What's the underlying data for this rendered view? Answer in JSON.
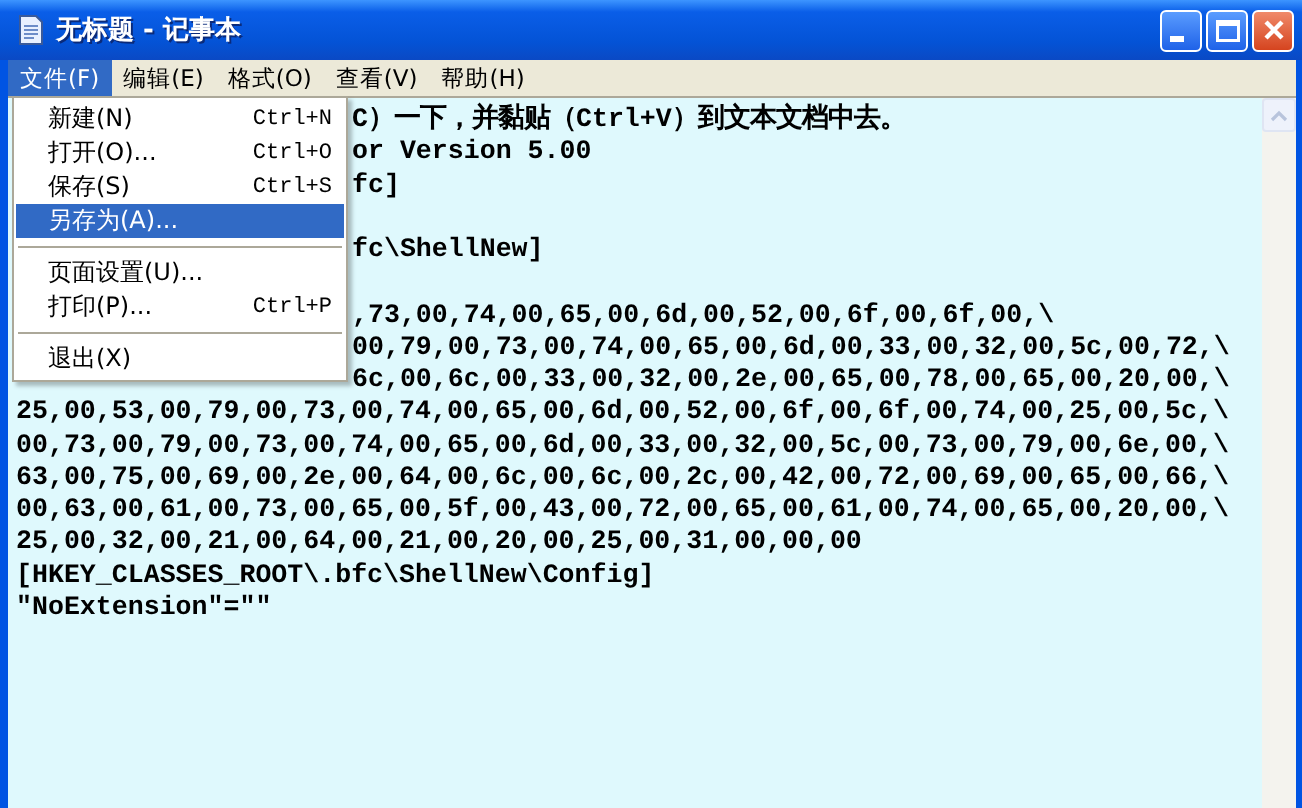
{
  "window": {
    "title": "无标题 - 记事本"
  },
  "menu_bar": [
    {
      "label": "文件(F)",
      "selected": true
    },
    {
      "label": "编辑(E)",
      "selected": false
    },
    {
      "label": "格式(O)",
      "selected": false
    },
    {
      "label": "查看(V)",
      "selected": false
    },
    {
      "label": "帮助(H)",
      "selected": false
    }
  ],
  "file_menu": [
    {
      "kind": "item",
      "label": "新建(N)",
      "shortcut": "Ctrl+N",
      "selected": false
    },
    {
      "kind": "item",
      "label": "打开(O)...",
      "shortcut": "Ctrl+O",
      "selected": false
    },
    {
      "kind": "item",
      "label": "保存(S)",
      "shortcut": "Ctrl+S",
      "selected": false
    },
    {
      "kind": "item",
      "label": "另存为(A)...",
      "selected": true
    },
    {
      "kind": "separator"
    },
    {
      "kind": "item",
      "label": "页面设置(U)...",
      "selected": false
    },
    {
      "kind": "item",
      "label": "打印(P)...",
      "shortcut": "Ctrl+P",
      "selected": false
    },
    {
      "kind": "separator"
    },
    {
      "kind": "item",
      "label": "退出(X)",
      "selected": false
    }
  ],
  "editor": {
    "lines": [
      {
        "kind": "text",
        "text": "C）一下，并黏贴（Ctrl+V）到文本文档中去。",
        "behind_menu": true
      },
      {
        "kind": "text",
        "text": "or Version 5.00",
        "behind_menu": true
      },
      {
        "kind": "text",
        "text": "fc]",
        "behind_menu": true
      },
      {
        "kind": "blank"
      },
      {
        "kind": "text",
        "text": "fc\\ShellNew]",
        "behind_menu": true
      },
      {
        "kind": "blank"
      },
      {
        "kind": "text",
        "text": ",73,00,74,00,65,00,6d,00,52,00,6f,00,6f,00,\\",
        "behind_menu": true
      },
      {
        "kind": "text",
        "text": "00,79,00,73,00,74,00,65,00,6d,00,33,00,32,00,5c,00,72,\\",
        "behind_menu": true
      },
      {
        "kind": "text",
        "text": "6c,00,6c,00,33,00,32,00,2e,00,65,00,78,00,65,00,20,00,\\",
        "behind_menu": true
      },
      {
        "kind": "text",
        "text": "25,00,53,00,79,00,73,00,74,00,65,00,6d,00,52,00,6f,00,6f,00,74,00,25,00,5c,\\"
      },
      {
        "kind": "text",
        "text": "00,73,00,79,00,73,00,74,00,65,00,6d,00,33,00,32,00,5c,00,73,00,79,00,6e,00,\\"
      },
      {
        "kind": "text",
        "text": "63,00,75,00,69,00,2e,00,64,00,6c,00,6c,00,2c,00,42,00,72,00,69,00,65,00,66,\\"
      },
      {
        "kind": "text",
        "text": "00,63,00,61,00,73,00,65,00,5f,00,43,00,72,00,65,00,61,00,74,00,65,00,20,00,\\"
      },
      {
        "kind": "text",
        "text": "25,00,32,00,21,00,64,00,21,00,20,00,25,00,31,00,00,00"
      },
      {
        "kind": "text",
        "text": "[HKEY_CLASSES_ROOT\\.bfc\\ShellNew\\Config]"
      },
      {
        "kind": "text",
        "text": "\"NoExtension\"=\"\""
      }
    ]
  }
}
